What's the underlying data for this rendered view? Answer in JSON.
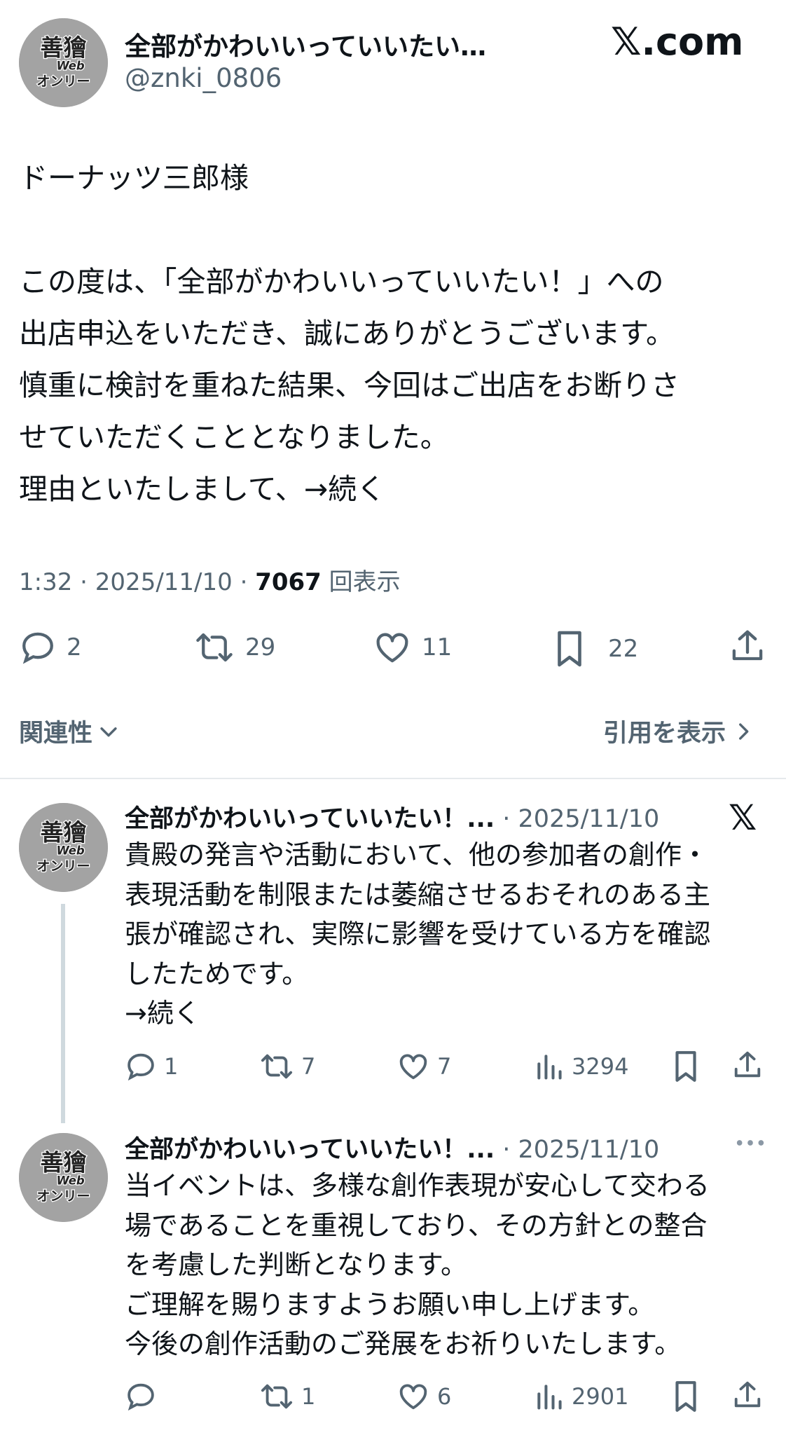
{
  "main_tweet": {
    "display_name": "全部がかわいいっていいたい…",
    "handle": "@znki_0806",
    "avatar_text": [
      "善",
      "獪",
      "Web",
      "オンリー"
    ],
    "x_logo": "𝕏.com",
    "body_lines": [
      "ドーナッツ三郎様",
      "",
      "この度は、「全部がかわいいっていいたい！」への",
      "出店申込をいただき、誠にありがとうございます。",
      "慎重に検討を重ねた結果、今回はご出店をお断りさ",
      "せていただくこととなりました。",
      "理由といたしまして、→続く"
    ],
    "time": "1:32",
    "date": "2025/11/10",
    "views": "7067",
    "views_suffix": "回表示",
    "replies": "2",
    "reposts": "29",
    "likes": "11",
    "bookmarks": "22",
    "sort_label": "関連性",
    "quotes_label": "引用を表示"
  },
  "replies": [
    {
      "display_name": "全部がかわいいっていいたい！...",
      "date": "· 2025/11/10",
      "lines": [
        "貴殿の発言や活動において、他の参加者の創作・",
        "表現活動を制限または萎縮させるおそれのある主",
        "張が確認され、実際に影響を受けている方を確認",
        "したためです。",
        "→続く"
      ],
      "replies": "1",
      "reposts": "7",
      "likes": "7",
      "views": "3294"
    },
    {
      "display_name": "全部がかわいいっていいたい！...",
      "date": "· 2025/11/10",
      "lines": [
        "当イベントは、多様な創作表現が安心して交わる",
        "場であることを重視しており、その方針との整合",
        "を考慮した判断となります。",
        "ご理解を賜りますようお願い申し上げます。",
        "今後の創作活動のご発展をお祈りいたします。"
      ],
      "replies": "",
      "reposts": "1",
      "likes": "6",
      "views": "2901"
    }
  ],
  "icons": [
    "reply-icon",
    "repost-icon",
    "like-icon",
    "bookmark-icon",
    "share-icon",
    "views-icon",
    "more-icon",
    "chevron-down-icon",
    "chevron-right-icon",
    "x-logo-icon"
  ],
  "colors": {
    "text": "#0f1419",
    "secondary": "#536471",
    "divider": "#e6e9ec",
    "avatar": "#9a9a9a"
  }
}
